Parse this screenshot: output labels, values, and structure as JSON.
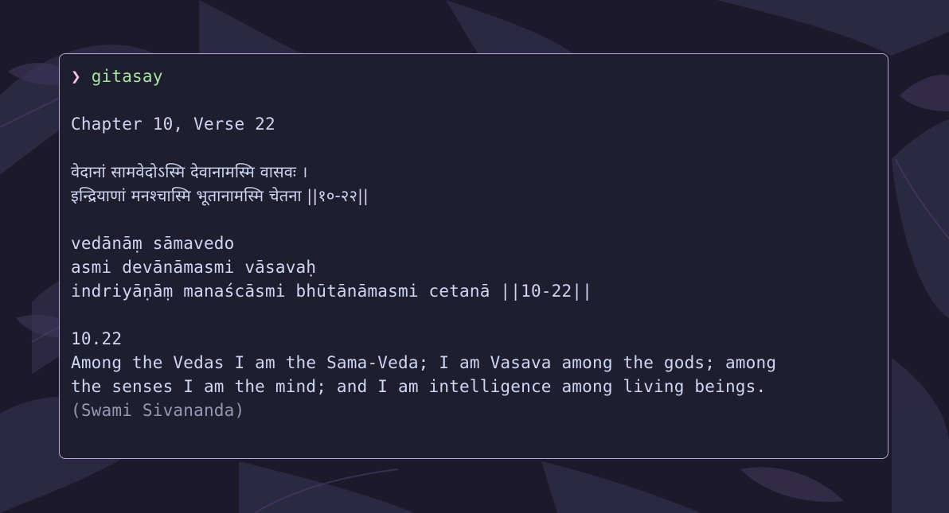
{
  "colors": {
    "terminal_background": "#1e1e2e",
    "terminal_border": "#b4a6d8",
    "text": "#cdd6f4",
    "prompt_symbol": "#f5c2e7",
    "command": "#a6e3a1",
    "muted_text": "#9399b2",
    "wallpaper": "#1c1a2a"
  },
  "terminal": {
    "prompt_symbol": "❯",
    "command": "gitasay",
    "heading": "Chapter 10, Verse 22",
    "devanagari": [
      "वेदानां सामवेदोऽस्मि देवानामस्मि वासवः ।",
      "इन्द्रियाणां मनश्चास्मि भूतानामस्मि चेतना ||१०-२२||"
    ],
    "transliteration": [
      "vedānāṃ sāmavedo",
      "asmi devānāmasmi vāsavaḥ",
      "indriyāṇāṃ manaścāsmi bhūtānāmasmi cetanā ||10-22||"
    ],
    "verse_number": "10.22",
    "translation": [
      "Among the Vedas I am the Sama-Veda; I am Vasava among the gods; among",
      "the senses I am the mind; and I am intelligence among living beings."
    ],
    "translator": "(Swami Sivananda)"
  }
}
